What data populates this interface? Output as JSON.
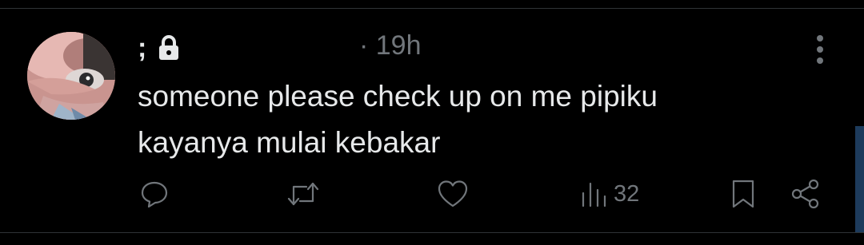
{
  "tweet": {
    "display_name": ";",
    "timestamp": "· 19h",
    "text_lines": [
      "someone please check up on me pipiku",
      "kayanya mulai kebakar"
    ],
    "icons": {
      "lock": "lock-icon",
      "more": "more-vertical-icon",
      "reply": "reply-icon",
      "retweet": "retweet-icon",
      "like": "heart-icon",
      "views": "views-bar-chart-icon",
      "bookmark": "bookmark-icon",
      "share": "share-icon"
    }
  },
  "actions": {
    "views_count": "32"
  },
  "colors": {
    "background": "#000000",
    "text_primary": "#e7e9ea",
    "text_secondary": "#71767b",
    "divider": "#2f3336"
  }
}
